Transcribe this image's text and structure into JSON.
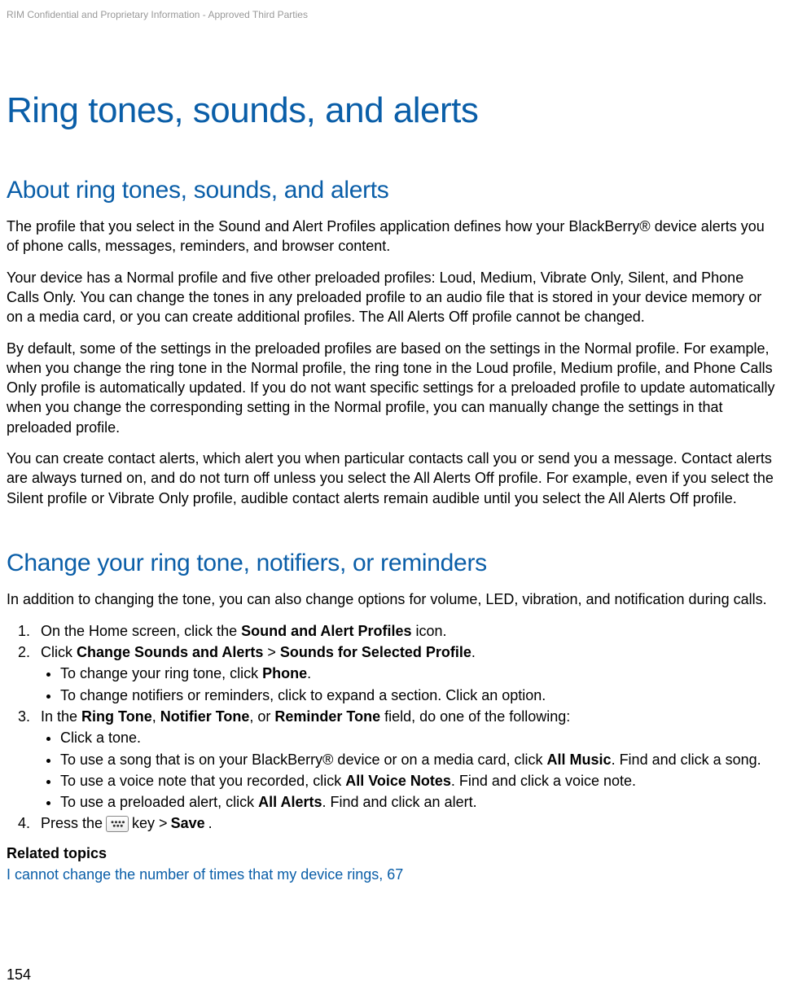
{
  "header": {
    "confidential": "RIM Confidential and Proprietary Information - Approved Third Parties"
  },
  "title": "Ring tones, sounds, and alerts",
  "section1": {
    "heading": "About ring tones, sounds, and alerts",
    "p1": "The profile that you select in the Sound and Alert Profiles application defines how your BlackBerry® device alerts you of phone calls, messages, reminders, and browser content.",
    "p2": "Your device has a Normal profile and five other preloaded profiles: Loud, Medium, Vibrate Only, Silent, and Phone Calls Only. You can change the tones in any preloaded profile to an audio file that is stored in your device memory or on a media card, or you can create additional profiles. The All Alerts Off profile cannot be changed.",
    "p3": "By default, some of the settings in the preloaded profiles are based on the settings in the Normal profile. For example, when you change the ring tone in the Normal profile, the ring tone in the Loud profile, Medium profile, and Phone Calls Only profile is automatically updated. If you do not want specific settings for a preloaded profile to update automatically when you change the corresponding setting in the Normal profile, you can manually change the settings in that preloaded profile.",
    "p4": "You can create contact alerts, which alert you when particular contacts call you or send you a message. Contact alerts are always turned on, and do not turn off unless you select the All Alerts Off profile. For example, even if you select the Silent profile or Vibrate Only profile, audible contact alerts remain audible until you select the All Alerts Off profile."
  },
  "section2": {
    "heading": "Change your ring tone, notifiers, or reminders",
    "intro": "In addition to changing the tone, you can also change options for volume, LED, vibration, and notification during calls.",
    "step1_pre": "On the Home screen, click the ",
    "step1_bold": "Sound and Alert Profiles",
    "step1_post": " icon.",
    "step2_pre": "Click ",
    "step2_b1": "Change Sounds and Alerts",
    "step2_mid": " > ",
    "step2_b2": "Sounds for Selected Profile",
    "step2_post": ".",
    "step2_sub1_pre": "To change your ring tone, click ",
    "step2_sub1_b": "Phone",
    "step2_sub1_post": ".",
    "step2_sub2": "To change notifiers or reminders, click to expand a section. Click an option.",
    "step3_pre": "In the ",
    "step3_b1": "Ring Tone",
    "step3_c1": ", ",
    "step3_b2": "Notifier Tone",
    "step3_c2": ", or ",
    "step3_b3": "Reminder Tone",
    "step3_post": " field, do one of the following:",
    "step3_sub1": "Click a tone.",
    "step3_sub2_pre": "To use a song that is on your BlackBerry® device or on a media card, click ",
    "step3_sub2_b": "All Music",
    "step3_sub2_post": ". Find and click a song.",
    "step3_sub3_pre": "To use a voice note that you recorded, click ",
    "step3_sub3_b": "All Voice Notes",
    "step3_sub3_post": ". Find and click a voice note.",
    "step3_sub4_pre": "To use a preloaded alert, click ",
    "step3_sub4_b": "All Alerts",
    "step3_sub4_post": ". Find and click an alert.",
    "step4_pre": "Press the ",
    "step4_mid": " key > ",
    "step4_b": "Save",
    "step4_post": "."
  },
  "related": {
    "heading": "Related topics",
    "link": "I cannot change the number of times that my device rings, 67"
  },
  "pageNumber": "154"
}
